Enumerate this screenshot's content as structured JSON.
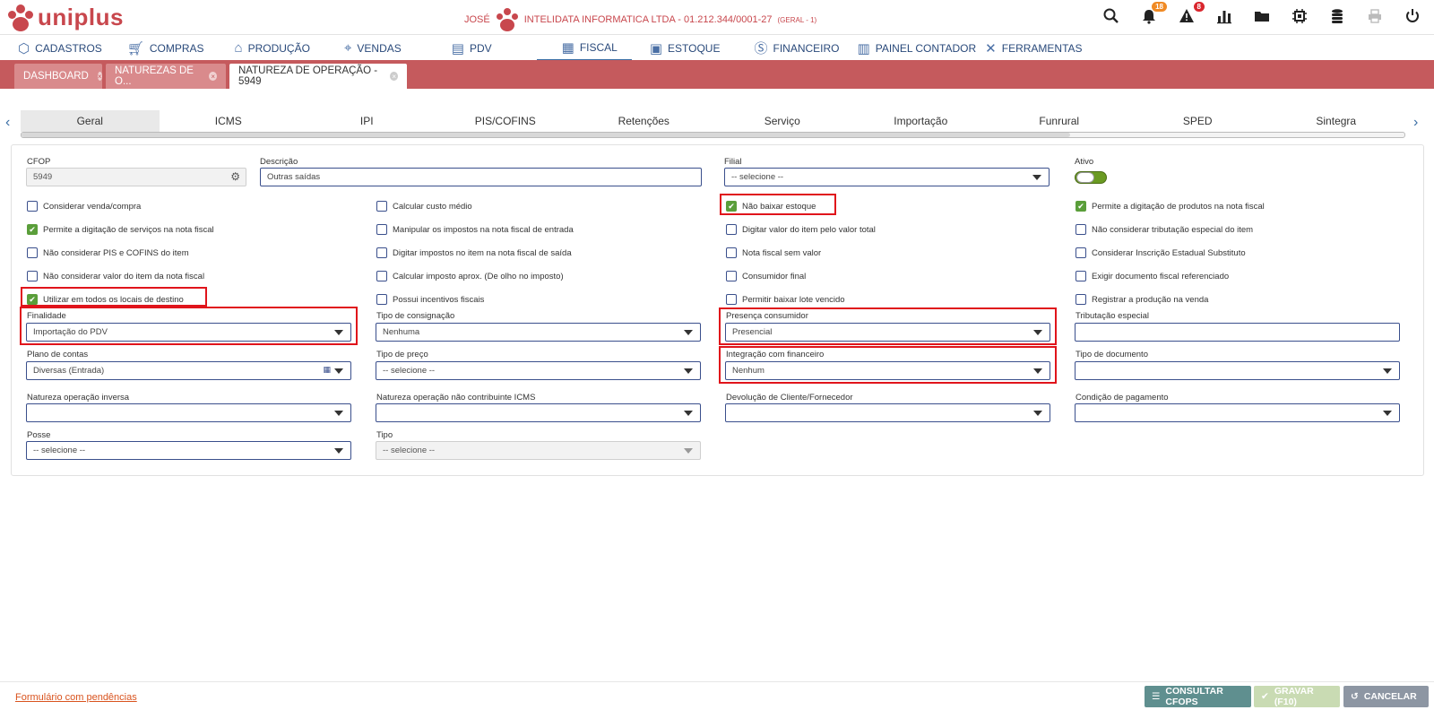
{
  "header": {
    "logo_text": "uniplus",
    "user": "JOSÉ",
    "company": "INTELIDATA INFORMATICA LTDA - 01.212.344/0001-27",
    "company_scope": "(GERAL - 1)",
    "notifications_count": "18",
    "alerts_count": "8",
    "accent_color": "#c8474d"
  },
  "menu": [
    {
      "label": "CADASTROS",
      "icon": "hexagon-icon"
    },
    {
      "label": "COMPRAS",
      "icon": "cart-icon"
    },
    {
      "label": "PRODUÇÃO",
      "icon": "factory-icon"
    },
    {
      "label": "VENDAS",
      "icon": "tag-icon"
    },
    {
      "label": "PDV",
      "icon": "register-icon"
    },
    {
      "label": "FISCAL",
      "icon": "document-icon"
    },
    {
      "label": "ESTOQUE",
      "icon": "box-icon"
    },
    {
      "label": "FINANCEIRO",
      "icon": "dollar-icon"
    },
    {
      "label": "PAINEL CONTADOR",
      "icon": "dashboard-icon"
    },
    {
      "label": "FERRAMENTAS",
      "icon": "tools-icon"
    }
  ],
  "doc_tabs": [
    {
      "label": "DASHBOARD"
    },
    {
      "label": "NATUREZAS DE O..."
    },
    {
      "label": "NATUREZA DE OPERAÇÃO - 5949"
    }
  ],
  "sub_tabs": [
    "Geral",
    "ICMS",
    "IPI",
    "PIS/COFINS",
    "Retenções",
    "Serviço",
    "Importação",
    "Funrural",
    "SPED",
    "Sintegra"
  ],
  "form": {
    "cfop": {
      "label": "CFOP",
      "value": "5949"
    },
    "descricao": {
      "label": "Descrição",
      "value": "Outras saídas"
    },
    "filial": {
      "label": "Filial",
      "value": "-- selecione --"
    },
    "ativo": {
      "label": "Ativo"
    },
    "checkboxes": [
      {
        "label": "Considerar venda/compra",
        "checked": false
      },
      {
        "label": "Calcular custo médio",
        "checked": false
      },
      {
        "label": "Não baixar estoque",
        "checked": true
      },
      {
        "label": "Permite a digitação de produtos na nota fiscal",
        "checked": true
      },
      {
        "label": "Permite a digitação de serviços na nota fiscal",
        "checked": true
      },
      {
        "label": "Manipular os impostos na nota fiscal de entrada",
        "checked": false
      },
      {
        "label": "Digitar valor do item pelo valor total",
        "checked": false
      },
      {
        "label": "Não considerar tributação especial do item",
        "checked": false
      },
      {
        "label": "Não considerar PIS e COFINS do item",
        "checked": false
      },
      {
        "label": "Digitar impostos no item na nota fiscal de saída",
        "checked": false
      },
      {
        "label": "Nota fiscal sem valor",
        "checked": false
      },
      {
        "label": "Considerar Inscrição Estadual Substituto",
        "checked": false
      },
      {
        "label": "Não considerar valor do item da nota fiscal",
        "checked": false
      },
      {
        "label": "Calcular imposto aprox. (De olho no imposto)",
        "checked": false
      },
      {
        "label": "Consumidor final",
        "checked": false
      },
      {
        "label": "Exigir documento fiscal referenciado",
        "checked": false
      },
      {
        "label": "Utilizar em todos os locais de destino",
        "checked": true
      },
      {
        "label": "Possui incentivos fiscais",
        "checked": false
      },
      {
        "label": "Permitir baixar lote vencido",
        "checked": false
      },
      {
        "label": "Registrar a produção na venda",
        "checked": false
      }
    ],
    "finalidade": {
      "label": "Finalidade",
      "value": "Importação do PDV"
    },
    "tipo_consignacao": {
      "label": "Tipo de consignação",
      "value": "Nenhuma"
    },
    "presenca_consumidor": {
      "label": "Presença consumidor",
      "value": "Presencial"
    },
    "tributacao_especial": {
      "label": "Tributação especial",
      "value": ""
    },
    "plano_contas": {
      "label": "Plano de contas",
      "value": "Diversas (Entrada)"
    },
    "tipo_preco": {
      "label": "Tipo de preço",
      "value": "-- selecione --"
    },
    "integracao_financeiro": {
      "label": "Integração com financeiro",
      "value": "Nenhum"
    },
    "tipo_documento": {
      "label": "Tipo de documento",
      "value": ""
    },
    "natureza_inversa": {
      "label": "Natureza operação inversa",
      "value": ""
    },
    "natureza_nao_contribuinte": {
      "label": "Natureza operação não contribuinte ICMS",
      "value": ""
    },
    "devolucao": {
      "label": "Devolução de Cliente/Fornecedor",
      "value": ""
    },
    "condicao_pagamento": {
      "label": "Condição de pagamento",
      "value": ""
    },
    "posse": {
      "label": "Posse",
      "value": "-- selecione --"
    },
    "tipo": {
      "label": "Tipo",
      "value": "-- selecione --"
    }
  },
  "footer": {
    "pending_link": "Formulário com pendências",
    "consultar": "CONSULTAR CFOPS",
    "gravar": "GRAVAR (F10)",
    "cancelar": "CANCELAR"
  }
}
